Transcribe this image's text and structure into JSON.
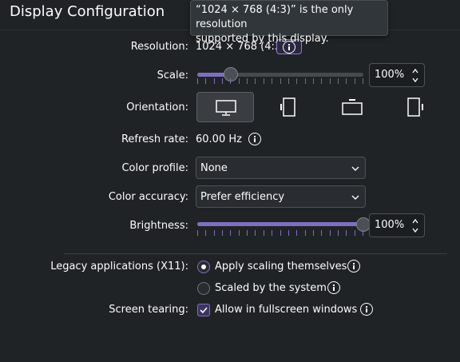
{
  "header": {
    "title": "Display Configuration"
  },
  "tooltip": {
    "line1": "“1024 × 768 (4:3)” is the only resolution",
    "line2": "supported by this display."
  },
  "resolution": {
    "label": "Resolution:",
    "value": "1024 × 768 (4:3)"
  },
  "scale": {
    "label": "Scale:",
    "value": "100%",
    "slider_fraction": 0.2
  },
  "orientation": {
    "label": "Orientation:",
    "options": [
      "landscape-icon",
      "portrait-icon",
      "inverted-landscape-icon",
      "inverted-portrait-icon"
    ],
    "selected_index": 0
  },
  "refresh_rate": {
    "label": "Refresh rate:",
    "value": "60.00 Hz"
  },
  "color_profile": {
    "label": "Color profile:",
    "value": "None"
  },
  "color_accuracy": {
    "label": "Color accuracy:",
    "value": "Prefer efficiency"
  },
  "brightness": {
    "label": "Brightness:",
    "value": "100%",
    "slider_fraction": 1.0
  },
  "legacy": {
    "label": "Legacy applications (X11):",
    "option1": "Apply scaling themselves",
    "option2": "Scaled by the system",
    "selected": 1
  },
  "tearing": {
    "label": "Screen tearing:",
    "option": "Allow in fullscreen windows",
    "checked": true
  },
  "colors": {
    "accent": "#7e6fc1",
    "background": "#202326",
    "text": "#fcfcfc"
  }
}
